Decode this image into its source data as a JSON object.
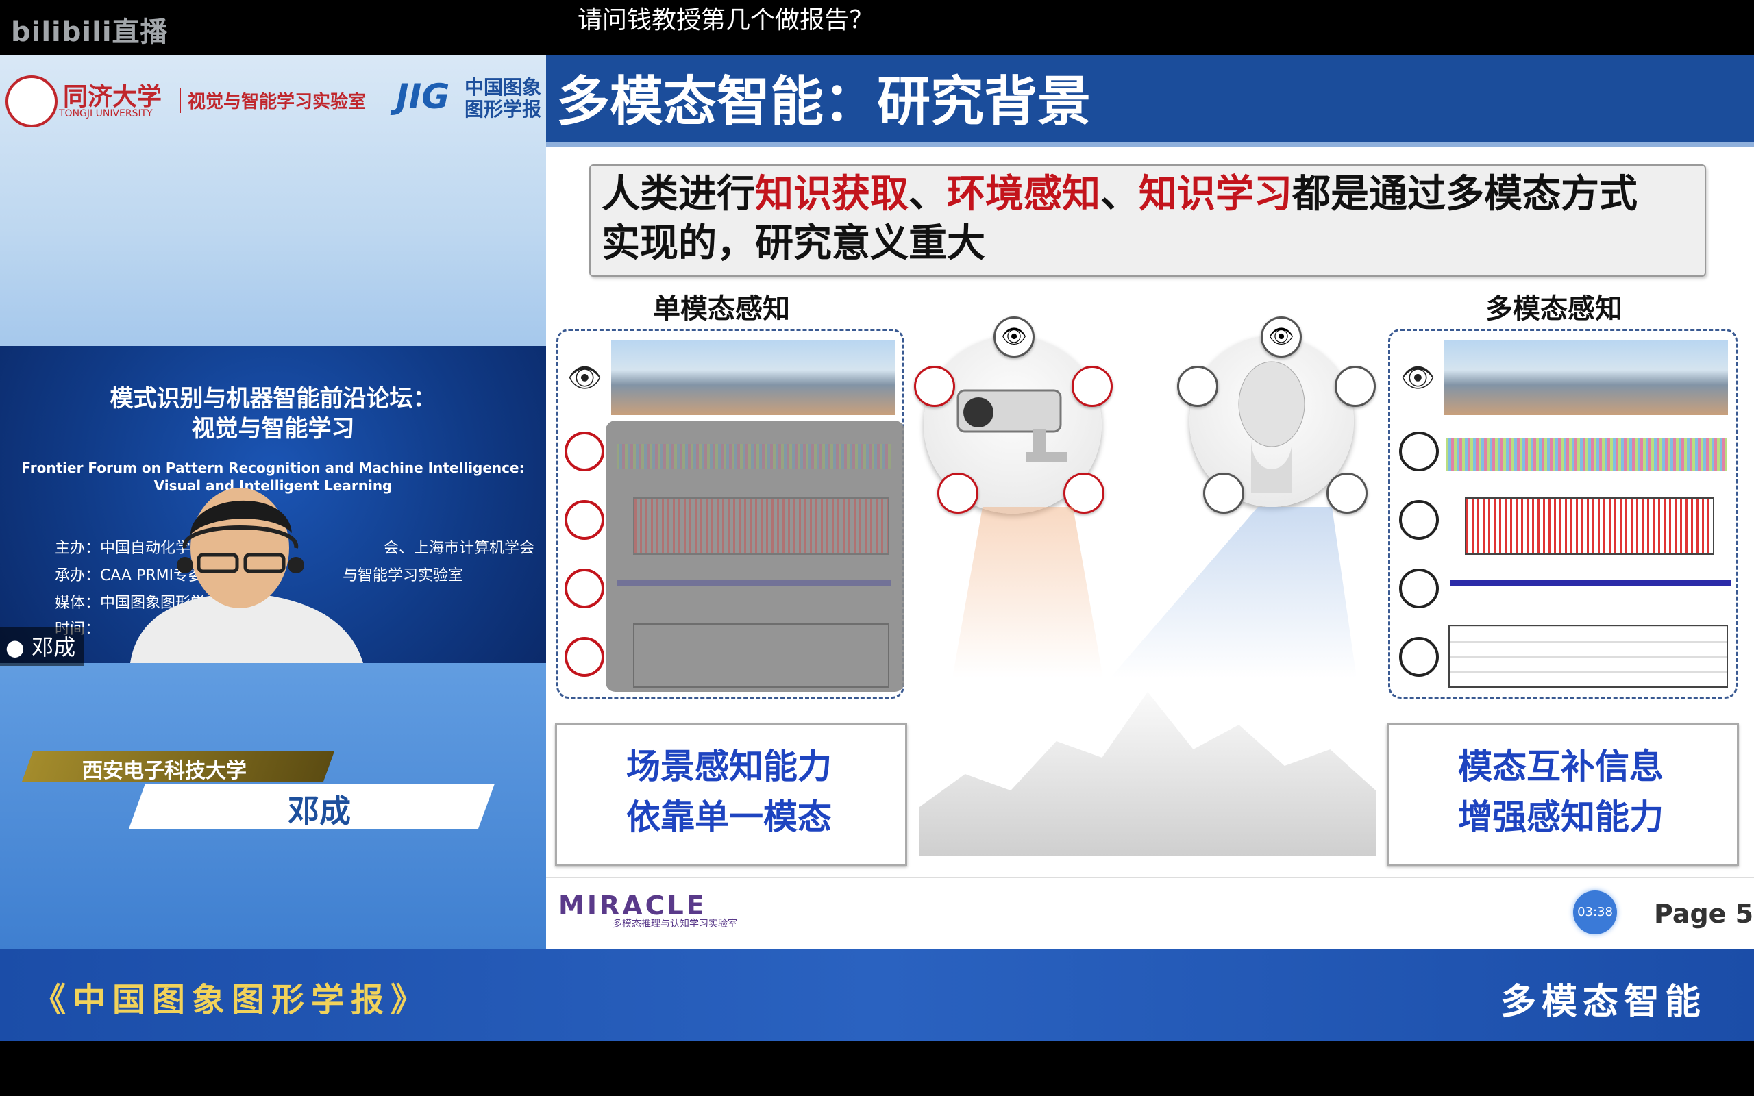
{
  "platform": {
    "logo_text": "bilibili直播"
  },
  "danmaku": {
    "text": "请问钱教授第几个做报告？"
  },
  "left": {
    "tongji_name": "同济大学",
    "tongji_en": "TONGJI UNIVERSITY",
    "lab_name": "视觉与智能学习实验室",
    "jig_logo": "JIG",
    "jig_text_line1": "中国图象",
    "jig_text_line2": "图形学报",
    "forum_title_line1": "模式识别与机器智能前沿论坛：",
    "forum_title_line2": "视觉与智能学习",
    "forum_en_line1": "Frontier Forum on Pattern Recognition and Machine Intelligence:",
    "forum_en_line2": "Visual and Intelligent Learning",
    "org_host": "主办：中国自动化学会、",
    "org_host2": "会、上海市计算机学会",
    "org_undertake": "承办：CAA PRMI专委",
    "org_undertake2": "与智能学习实验室",
    "org_media": "媒体：中国图象图形学",
    "org_time": "时间：",
    "speaker_tag": "邓成",
    "university": "西安电子科技大学",
    "speaker_name": "邓成"
  },
  "slide": {
    "title": "多模态智能：研究背景",
    "statement": {
      "p1": "人类进行",
      "r1": "知识获取",
      "s1": "、",
      "r2": "环境感知",
      "s2": "、",
      "r3": "知识学习",
      "p2": "都是通过多模态方式",
      "line2": "实现的，研究意义重大"
    },
    "single_title": "单模态感知",
    "multi_title": "多模态感知",
    "left_box_line1": "场景感知能力",
    "left_box_line2": "依靠单一模态",
    "right_box_line1": "模态互补信息",
    "right_box_line2": "增强感知能力",
    "lab_logo": "MIRACLE",
    "lab_sub": "多模态推理与认知学习实验室",
    "timer": "03:38",
    "page": "Page 5"
  },
  "bottom": {
    "journal": "《中国图象图形学报》",
    "topic": "多模态智能"
  }
}
